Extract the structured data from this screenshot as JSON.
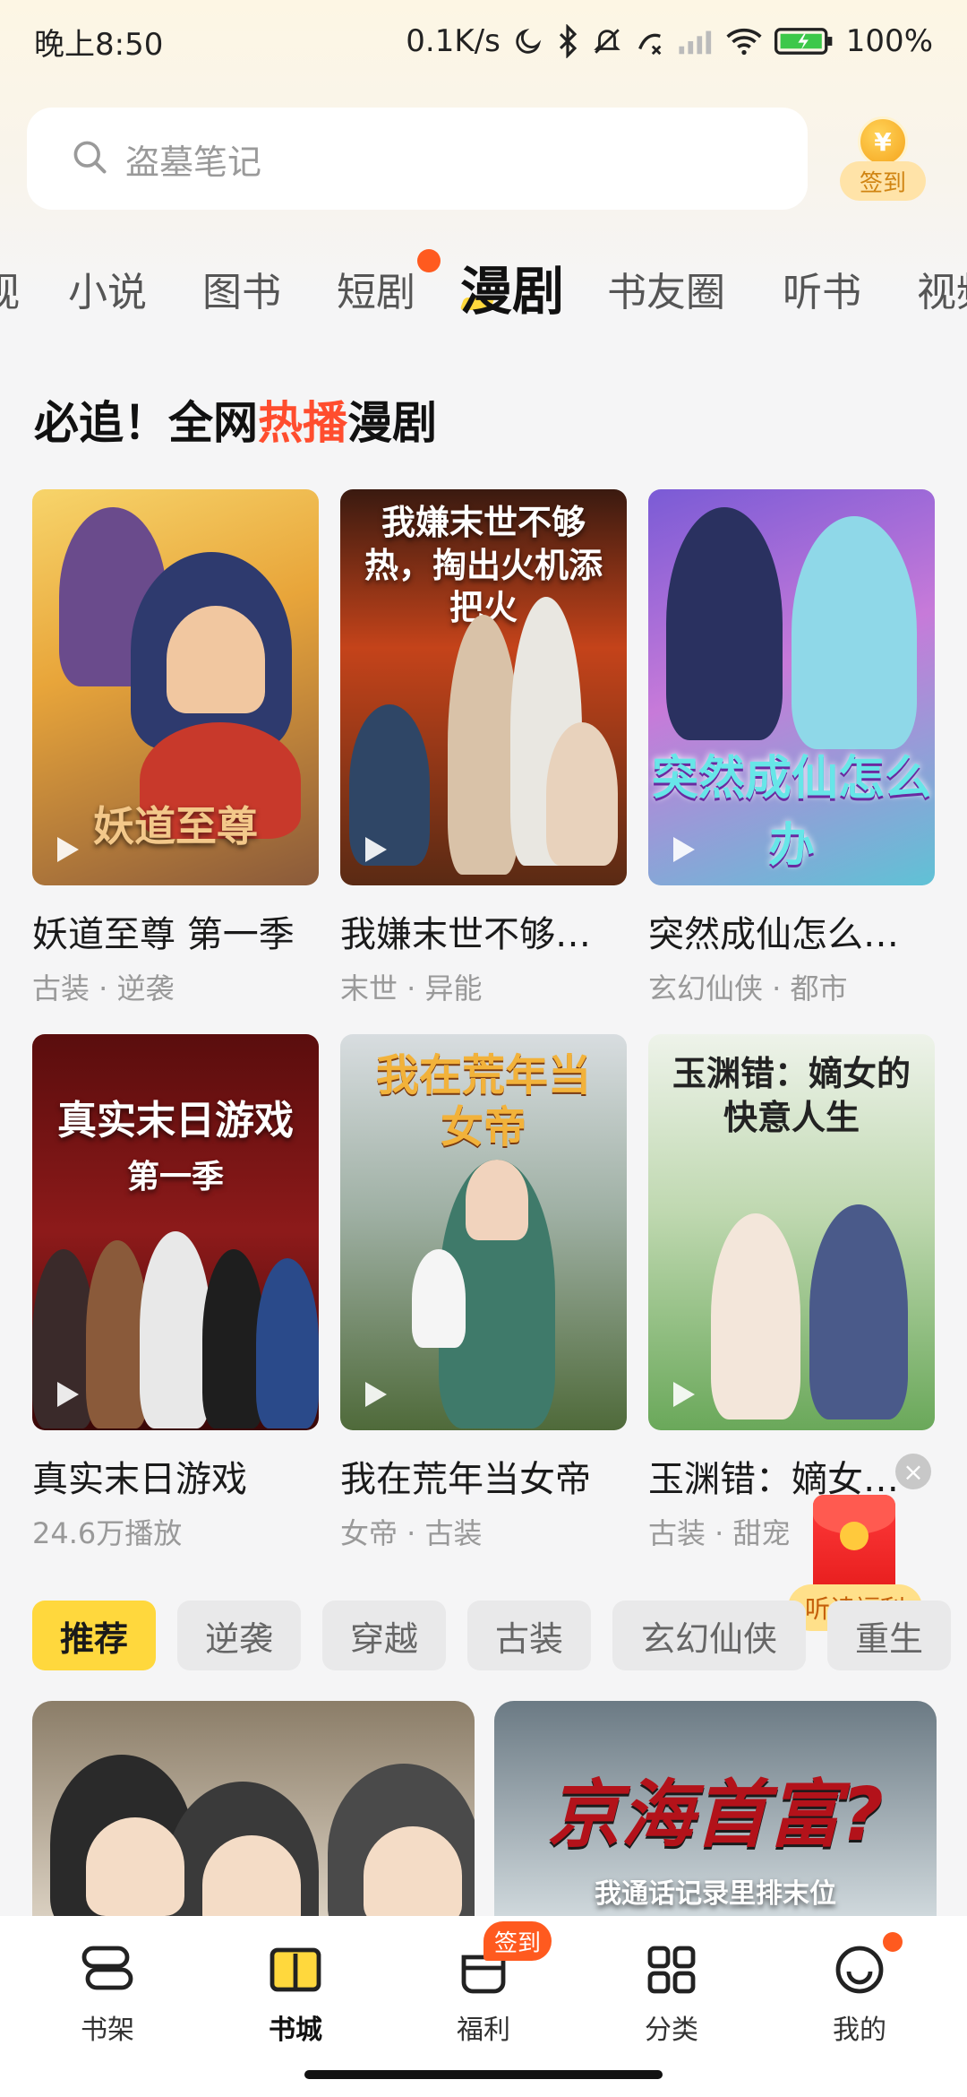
{
  "status_bar": {
    "time": "晚上8:50",
    "network_speed": "0.1K/s",
    "battery": "100%"
  },
  "search": {
    "placeholder": "盗墓笔记"
  },
  "checkin": {
    "coin_symbol": "¥",
    "label": "签到"
  },
  "tabs": [
    {
      "label": "视"
    },
    {
      "label": "小说"
    },
    {
      "label": "图书"
    },
    {
      "label": "短剧"
    },
    {
      "label": "漫剧"
    },
    {
      "label": "书友圈"
    },
    {
      "label": "听书"
    },
    {
      "label": "视频"
    }
  ],
  "section": {
    "title_prefix": "必追！全网",
    "title_highlight": "热播",
    "title_suffix": "漫剧"
  },
  "cards": [
    {
      "title": "妖道至尊 第一季",
      "meta": "古装 · 逆袭",
      "cover_text": "妖道至尊"
    },
    {
      "title": "我嫌末世不够…",
      "meta": "末世 · 异能",
      "cover_text": "我嫌末世不够热，掏出火机添把火"
    },
    {
      "title": "突然成仙怎么…",
      "meta": "玄幻仙侠 · 都市",
      "cover_text": "突然成仙怎么办"
    },
    {
      "title": "真实末日游戏",
      "meta": "24.6万播放",
      "cover_text": "真实末日游戏",
      "cover_sub": "第一季"
    },
    {
      "title": "我在荒年当女帝",
      "meta": "女帝 · 古装",
      "cover_text": "我在荒年当女帝"
    },
    {
      "title": "玉渊错：嫡女…",
      "meta": "古装 · 甜宠",
      "cover_text": "玉渊错：嫡女的快意人生"
    }
  ],
  "floating": {
    "label": "听读福利",
    "close": "×"
  },
  "chips": [
    {
      "label": "推荐"
    },
    {
      "label": "逆袭"
    },
    {
      "label": "穿越"
    },
    {
      "label": "古装"
    },
    {
      "label": "玄幻仙侠"
    },
    {
      "label": "重生"
    }
  ],
  "feed": [
    {
      "cover_text": ""
    },
    {
      "cover_text": "京海首富?",
      "cover_sub": "我通话记录里排末位"
    }
  ],
  "bottom_nav": {
    "items": [
      {
        "label": "书架"
      },
      {
        "label": "书城"
      },
      {
        "label": "福利"
      },
      {
        "label": "分类"
      },
      {
        "label": "我的"
      }
    ],
    "badge": "签到"
  },
  "colors": {
    "accent_yellow": "#ffd83d",
    "hot_red": "#ff4d2e",
    "badge_orange": "#ff5a1f"
  }
}
